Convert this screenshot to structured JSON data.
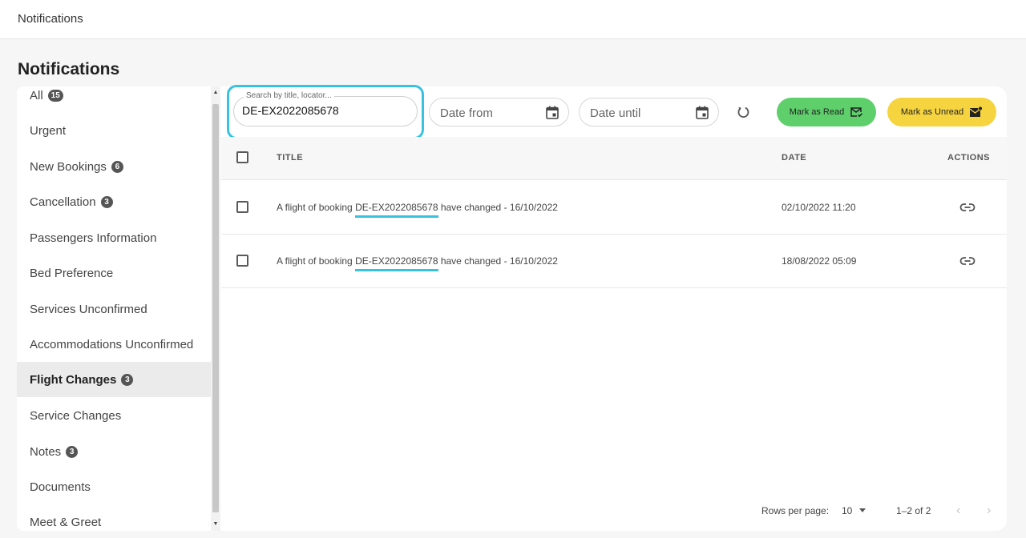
{
  "topbar": {
    "breadcrumb": "Notifications"
  },
  "page": {
    "title": "Notifications"
  },
  "sidebar": {
    "items": [
      {
        "label": "All",
        "badge": "15"
      },
      {
        "label": "Urgent",
        "badge": ""
      },
      {
        "label": "New Bookings",
        "badge": "6"
      },
      {
        "label": "Cancellation",
        "badge": "3"
      },
      {
        "label": "Passengers Information",
        "badge": ""
      },
      {
        "label": "Bed Preference",
        "badge": ""
      },
      {
        "label": "Services Unconfirmed",
        "badge": ""
      },
      {
        "label": "Accommodations Unconfirmed",
        "badge": ""
      },
      {
        "label": "Flight Changes",
        "badge": "3",
        "active": true
      },
      {
        "label": "Service Changes",
        "badge": ""
      },
      {
        "label": "Notes",
        "badge": "3"
      },
      {
        "label": "Documents",
        "badge": ""
      },
      {
        "label": "Meet & Greet",
        "badge": ""
      }
    ]
  },
  "filters": {
    "search_label": "Search by title, locator...",
    "search_value": "DE-EX2022085678",
    "date_from_placeholder": "Date from",
    "date_until_placeholder": "Date until"
  },
  "actions": {
    "mark_read": "Mark as Read",
    "mark_unread": "Mark as Unread"
  },
  "table": {
    "columns": {
      "title": "TITLE",
      "date": "DATE",
      "actions": "ACTIONS"
    },
    "rows": [
      {
        "prefix": "A flight of booking ",
        "locator": "DE-EX2022085678",
        "suffix": " have changed - 16/10/2022",
        "date": "02/10/2022 11:20"
      },
      {
        "prefix": "A flight of booking ",
        "locator": "DE-EX2022085678",
        "suffix": " have changed - 16/10/2022",
        "date": "18/08/2022 05:09"
      }
    ]
  },
  "pagination": {
    "rows_per_page_label": "Rows per page:",
    "rows_per_page_value": "10",
    "range": "1–2 of 2",
    "prev": "‹",
    "next": "›"
  },
  "colors": {
    "highlight": "#38c2e0",
    "mark_read_bg": "#5fcf6c",
    "mark_unread_bg": "#f6d43f"
  }
}
